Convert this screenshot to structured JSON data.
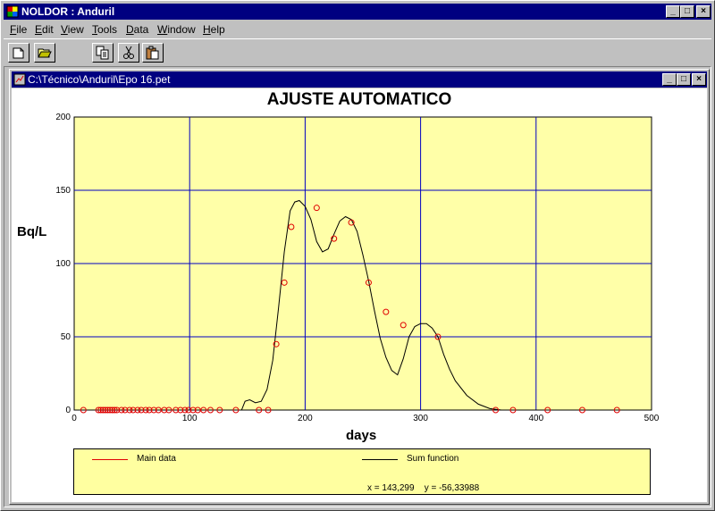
{
  "app": {
    "title": "NOLDOR : Anduril",
    "caption_buttons": {
      "minimize": "_",
      "maximize": "□",
      "close": "×"
    }
  },
  "menu": [
    {
      "label": "File",
      "key": "F"
    },
    {
      "label": "Edit",
      "key": "E"
    },
    {
      "label": "View",
      "key": "V"
    },
    {
      "label": "Tools",
      "key": "T"
    },
    {
      "label": "Data",
      "key": "D"
    },
    {
      "label": "Window",
      "key": "W"
    },
    {
      "label": "Help",
      "key": "H"
    }
  ],
  "toolbar": {
    "buttons": [
      "new-icon",
      "open-icon",
      "copy-icon",
      "cut-icon",
      "paste-icon"
    ]
  },
  "document": {
    "title": "C:\\Técnico\\Anduril\\Epo 16.pet"
  },
  "colors": {
    "plot_bg": "#ffffa8",
    "grid": "#0000c0",
    "marker": "#e00000",
    "curve": "#000000",
    "titlebar": "#000080"
  },
  "chart_data": {
    "type": "scatter",
    "title": "AJUSTE AUTOMATICO",
    "xlabel": "days",
    "ylabel": "Bq/L",
    "xlim": [
      0,
      500
    ],
    "ylim": [
      0,
      200
    ],
    "xticks": [
      "0",
      "100",
      "200",
      "300",
      "400",
      "500"
    ],
    "yticks": [
      "0",
      "50",
      "100",
      "150",
      "200"
    ],
    "grid": true,
    "legend_position": "bottom",
    "series": [
      {
        "name": "Main data",
        "style": "markers",
        "x": [
          8,
          21,
          23,
          25,
          27,
          29,
          31,
          33,
          35,
          37,
          41,
          44,
          48,
          51,
          55,
          58,
          62,
          65,
          69,
          73,
          78,
          82,
          88,
          92,
          96,
          99,
          103,
          107,
          112,
          118,
          126,
          140,
          160,
          168,
          175,
          182,
          188,
          210,
          225,
          240,
          255,
          270,
          285,
          315,
          365,
          380,
          410,
          440,
          470
        ],
        "y": [
          0,
          0,
          0,
          0,
          0,
          0,
          0,
          0,
          0,
          0,
          0,
          0,
          0,
          0,
          0,
          0,
          0,
          0,
          0,
          0,
          0,
          0,
          0,
          0,
          0,
          0,
          0,
          0,
          0,
          0,
          0,
          0,
          0,
          0,
          45,
          87,
          125,
          138,
          117,
          128,
          87,
          67,
          58,
          50,
          0,
          0,
          0,
          0,
          0
        ]
      },
      {
        "name": "Sum function",
        "style": "line",
        "x": [
          0,
          135,
          140,
          145,
          148,
          152,
          157,
          162,
          167,
          172,
          177,
          182,
          187,
          191,
          195,
          200,
          205,
          210,
          215,
          220,
          225,
          230,
          235,
          240,
          245,
          250,
          255,
          260,
          265,
          270,
          275,
          280,
          285,
          290,
          295,
          300,
          305,
          310,
          315,
          320,
          325,
          330,
          340,
          350,
          360,
          370,
          380,
          500
        ],
        "y": [
          0,
          0,
          0,
          0,
          6,
          7,
          5,
          6,
          14,
          34,
          70,
          108,
          136,
          142,
          143,
          139,
          130,
          115,
          108,
          110,
          120,
          129,
          132,
          130,
          122,
          106,
          88,
          68,
          49,
          36,
          27,
          24,
          35,
          50,
          57,
          59,
          59,
          56,
          50,
          38,
          28,
          20,
          10,
          4,
          1,
          0,
          0,
          0
        ]
      }
    ]
  },
  "legend": {
    "main_label": "Main data",
    "sum_label": "Sum function"
  },
  "cursor": {
    "x_label": "x =",
    "x_value": "143,299",
    "y_label": "y =",
    "y_value": "-56,33988"
  }
}
